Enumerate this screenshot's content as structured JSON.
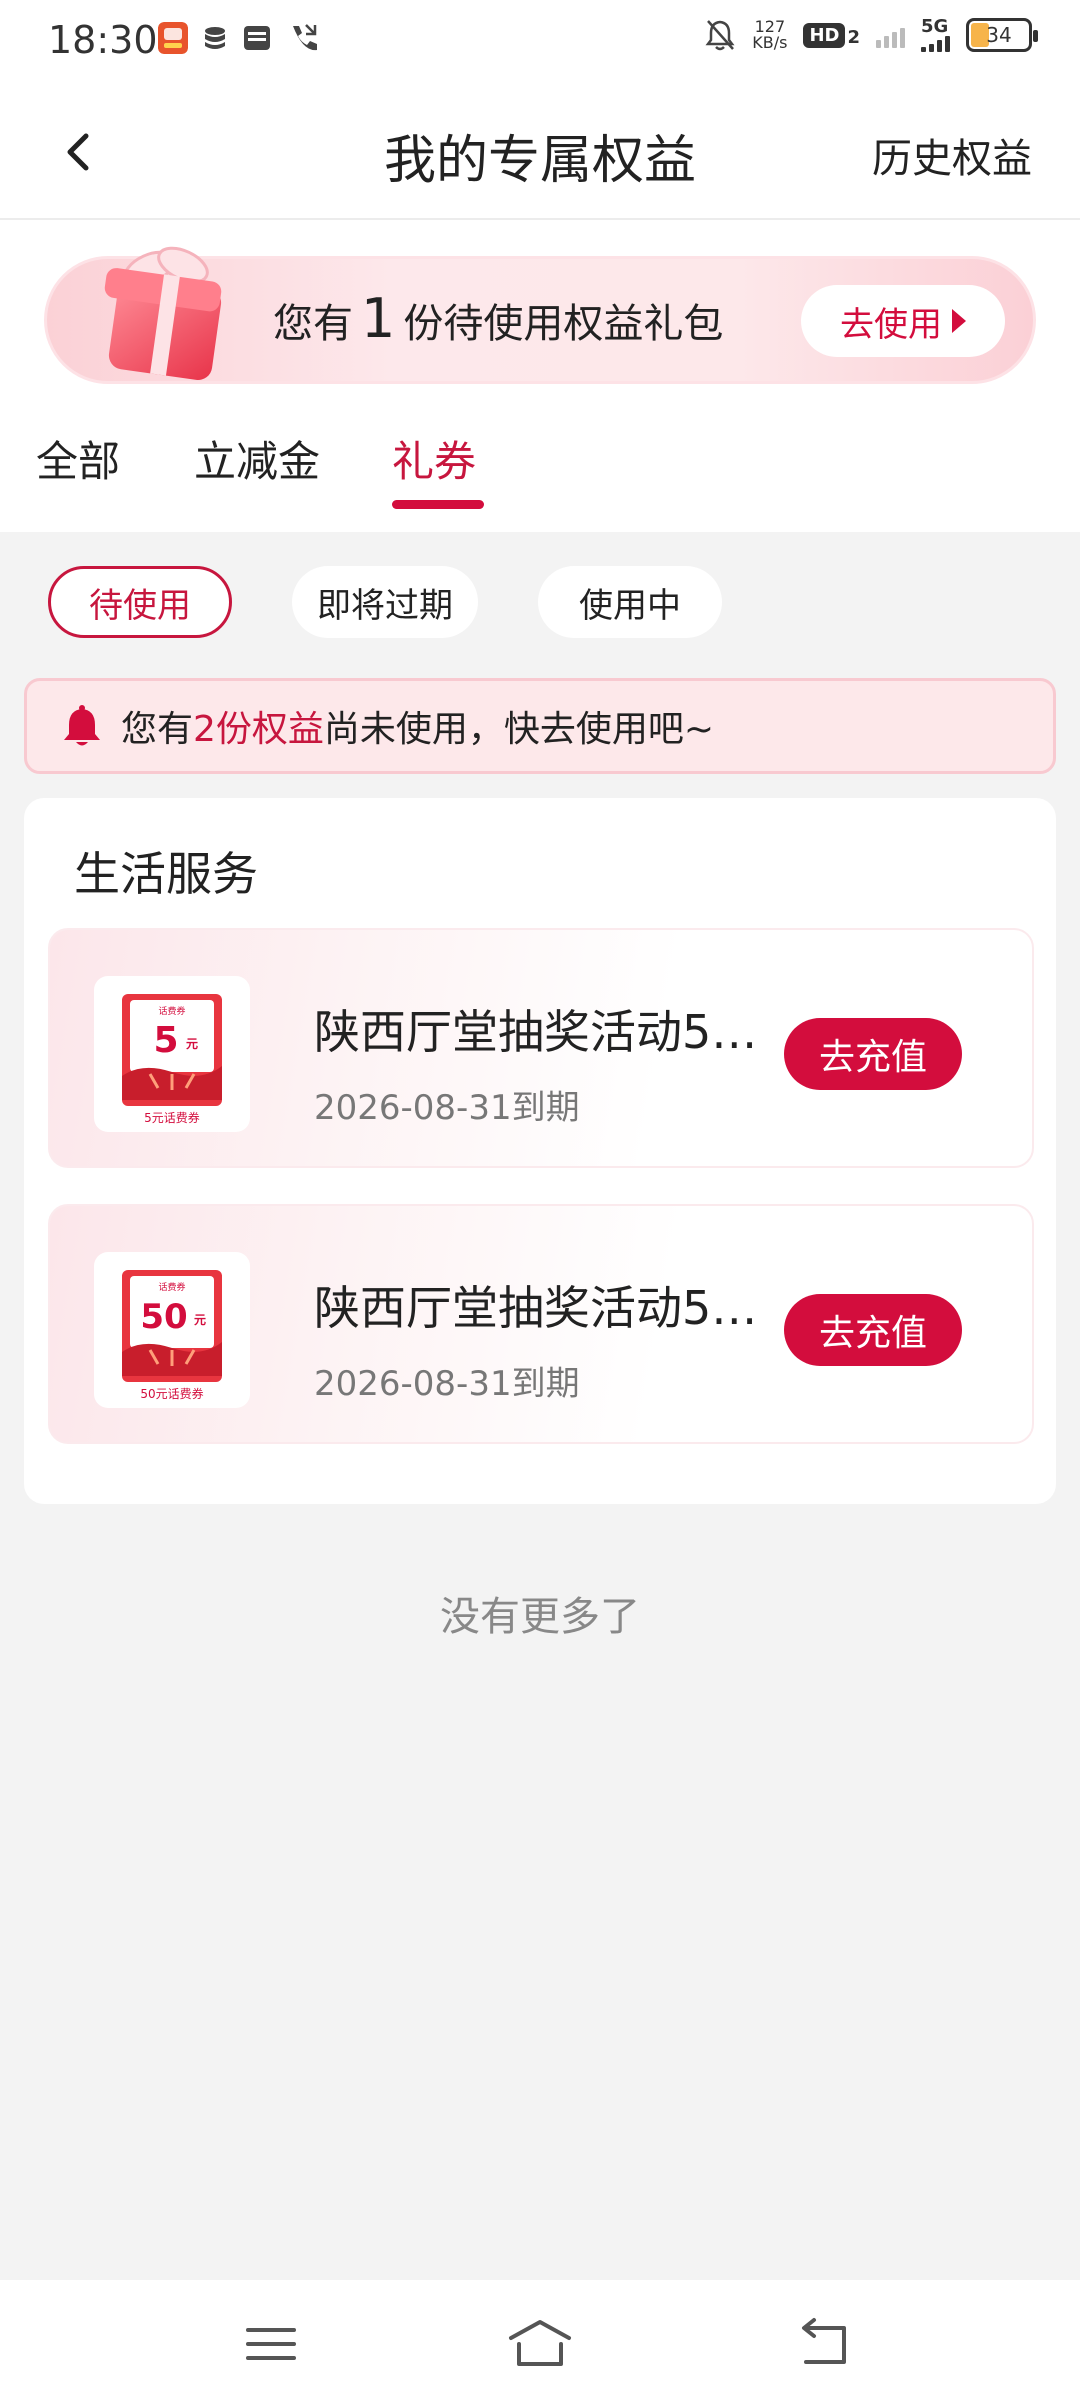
{
  "status_bar": {
    "time": "18:30",
    "net_speed_value": "127",
    "net_speed_unit": "KB/s",
    "hd_label": "HD",
    "hd_sub": "2",
    "network": "5G",
    "battery": "34",
    "icons": [
      "app-icon",
      "storage-icon",
      "sim-card-icon",
      "phone-icon",
      "bell-off-icon",
      "signal-icon"
    ]
  },
  "header": {
    "title": "我的专属权益",
    "history_link": "历史权益",
    "back_icon": "chevron-left-icon"
  },
  "banner": {
    "text_prefix": "您有",
    "count": "1",
    "text_suffix": "份待使用权益礼包",
    "button_label": "去使用"
  },
  "tabs": [
    {
      "label": "全部",
      "active": false
    },
    {
      "label": "立减金",
      "active": false
    },
    {
      "label": "礼券",
      "active": true
    }
  ],
  "filters": [
    {
      "label": "待使用",
      "active": true
    },
    {
      "label": "即将过期",
      "active": false
    },
    {
      "label": "使用中",
      "active": false
    }
  ],
  "notice": {
    "prefix": "您有",
    "highlight": "2份权益",
    "suffix": "尚未使用，快去使用吧~"
  },
  "section": {
    "title": "生活服务",
    "coupons": [
      {
        "title": "陕西厅堂抽奖活动5…",
        "expiry": "2026-08-31到期",
        "button_label": "去充值",
        "image": {
          "top_label": "话费券",
          "amount": "5",
          "unit": "元",
          "caption": "5元话费券"
        }
      },
      {
        "title": "陕西厅堂抽奖活动5…",
        "expiry": "2026-08-31到期",
        "button_label": "去充值",
        "image": {
          "top_label": "话费券",
          "amount": "50",
          "unit": "元",
          "caption": "50元话费券"
        }
      }
    ]
  },
  "footer_text": "没有更多了",
  "nav_bar": {
    "icons": [
      "menu-icon",
      "home-icon",
      "back-icon"
    ]
  },
  "colors": {
    "accent": "#d30d3d",
    "accent_text": "#c7163e",
    "background": "#f3f3f3"
  }
}
